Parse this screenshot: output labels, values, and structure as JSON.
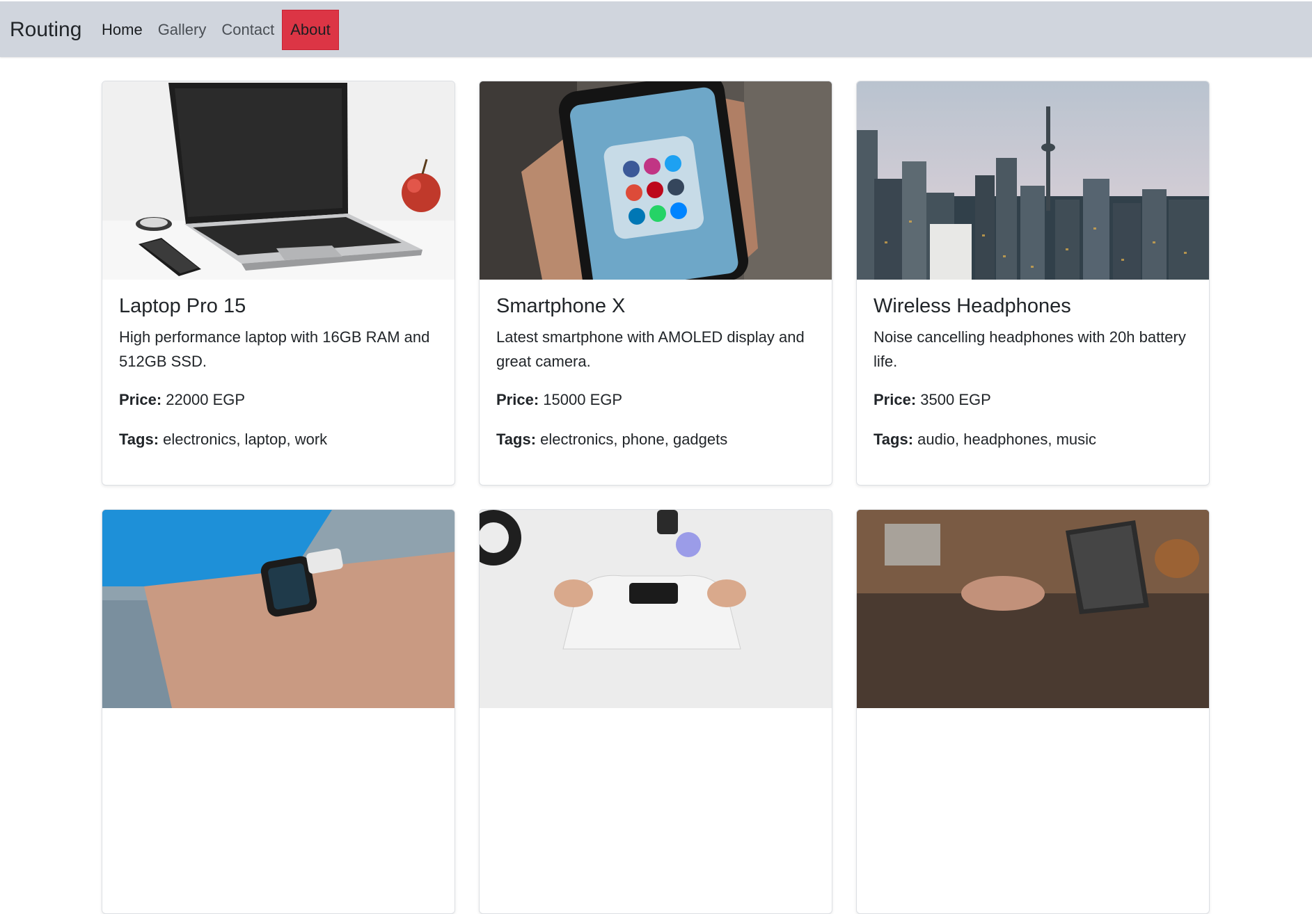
{
  "nav": {
    "brand": "Routing",
    "links": [
      {
        "label": "Home"
      },
      {
        "label": "Gallery"
      },
      {
        "label": "Contact"
      },
      {
        "label": "About",
        "active": true
      }
    ],
    "active_color": "#dc3545",
    "background": "#d0d5dd"
  },
  "products": [
    {
      "title": "Laptop Pro 15",
      "description": "High performance laptop with 16GB RAM and 512GB SSD.",
      "price_label": "Price:",
      "price": "22000 EGP",
      "tags_label": "Tags:",
      "tags": "electronics, laptop, work",
      "image": "laptop-on-desk-photo"
    },
    {
      "title": "Smartphone X",
      "description": "Latest smartphone with AMOLED display and great camera.",
      "price_label": "Price:",
      "price": "15000 EGP",
      "tags_label": "Tags:",
      "tags": "electronics, phone, gadgets",
      "image": "smartphone-in-hand-photo"
    },
    {
      "title": "Wireless Headphones",
      "description": "Noise cancelling headphones with 20h battery life.",
      "price_label": "Price:",
      "price": "3500 EGP",
      "tags_label": "Tags:",
      "tags": "audio, headphones, music",
      "image": "city-skyline-photo"
    },
    {
      "image": "smartwatch-on-wrist-photo"
    },
    {
      "image": "game-controller-photo"
    },
    {
      "image": "laptop-cafe-photo"
    }
  ]
}
